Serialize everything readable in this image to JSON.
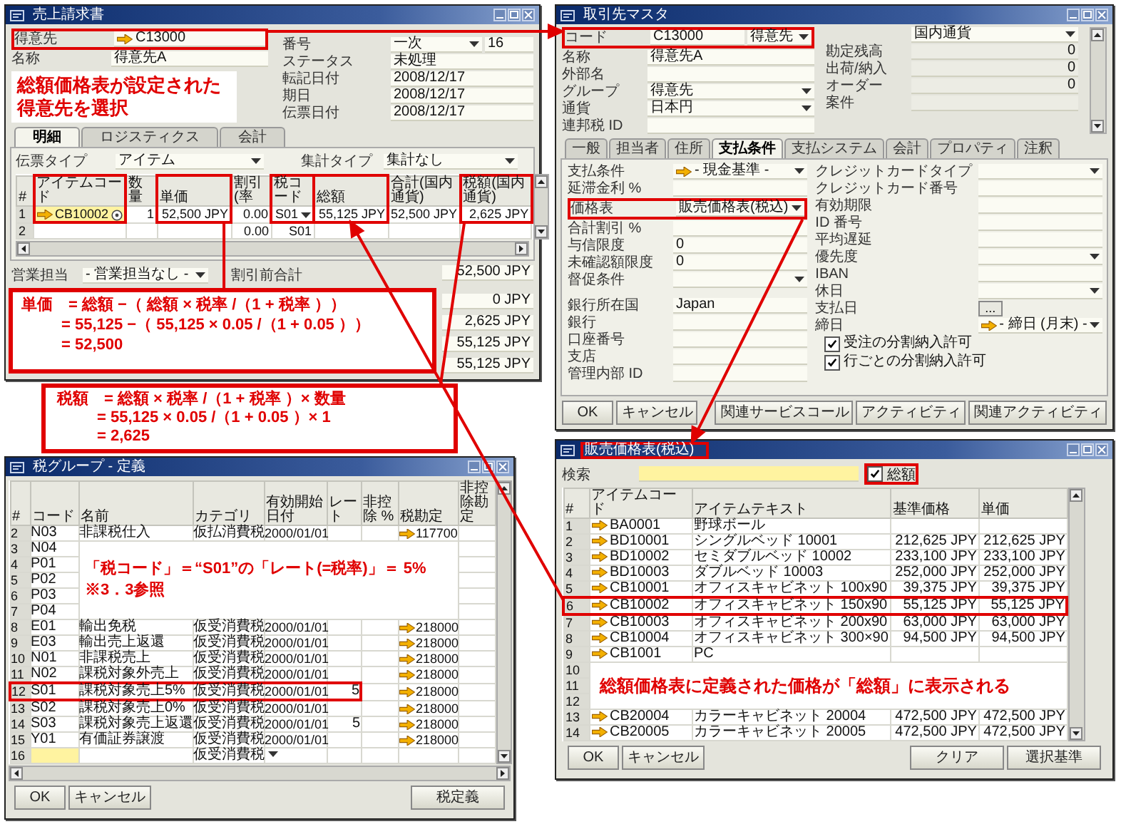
{
  "invoice": {
    "title": "売上請求書",
    "header_left": [
      {
        "label": "得意先",
        "value": "C13000",
        "link": true,
        "highlighted": true
      },
      {
        "label": "名称",
        "value": "得意先A",
        "link": false,
        "highlighted": false
      }
    ],
    "note": "総額価格表が設定された得意先を選択",
    "header_right": [
      {
        "label": "番号",
        "value": "一次",
        "dropdown": true,
        "extra": "16"
      },
      {
        "label": "ステータス",
        "value": "未処理",
        "dropdown": false
      },
      {
        "label": "転記日付",
        "value": "2008/12/17",
        "dropdown": false
      },
      {
        "label": "期日",
        "value": "2008/12/17",
        "dropdown": false
      },
      {
        "label": "伝票日付",
        "value": "2008/12/17",
        "dropdown": false
      }
    ],
    "tabs": [
      {
        "label": "明細",
        "selected": true
      },
      {
        "label": "ロジスティクス",
        "selected": false
      },
      {
        "label": "会計",
        "selected": false
      }
    ],
    "doc_type": {
      "label": "伝票タイプ",
      "value": "アイテム"
    },
    "summary_type": {
      "label": "集計タイプ",
      "value": "集計なし"
    },
    "columns": [
      {
        "label": "#",
        "highlighted": false
      },
      {
        "label": "アイテムコード",
        "highlighted": true
      },
      {
        "label": "数量",
        "highlighted": false
      },
      {
        "label": "単価",
        "highlighted": true
      },
      {
        "label": "割引(率",
        "highlighted": false
      },
      {
        "label": "税コード",
        "highlighted": true
      },
      {
        "label": "総額",
        "highlighted": true
      },
      {
        "label": "合計(国内通貨)",
        "highlighted": false
      },
      {
        "label": "税額(国内通貨)",
        "highlighted": true
      }
    ],
    "rows": [
      {
        "active": true,
        "framed": true,
        "cells": [
          "1",
          "CB10002",
          "1",
          "52,500 JPY",
          "0.00",
          "S01",
          "55,125 JPY",
          "52,500 JPY",
          "2,625 JPY"
        ]
      },
      {
        "active": false,
        "framed": false,
        "cells": [
          "2",
          null,
          null,
          null,
          "0.00",
          "S01",
          null,
          null,
          null
        ]
      }
    ],
    "sales_rep": {
      "label": "営業担当",
      "value": "- 営業担当なし -"
    },
    "totals_label": "割引前合計",
    "totals": [
      "52,500 JPY",
      "0 JPY",
      "2,625 JPY",
      "55,125 JPY",
      "55,125 JPY"
    ],
    "formula": [
      "単価　= 総額 −（ 総額 × 税率 /（1 + 税率 ））",
      "= 55,125 −（ 55,125 × 0.05 /（1 + 0.05 ））",
      "= 52,500"
    ]
  },
  "tax_formula": [
    "税額　= 総額 × 税率 /（1 + 税率 ）× 数量",
    "= 55,125 × 0.05 /（1 + 0.05 ）× 1",
    "= 2,625"
  ],
  "business_partner": {
    "title": "取引先マスタ",
    "header_left": [
      {
        "label": "コード",
        "value": "C13000",
        "option": "得意先",
        "highlighted": true
      },
      {
        "label": "名称",
        "value": "得意先A",
        "highlighted": false
      },
      {
        "label": "外部名",
        "highlighted": false
      },
      {
        "label": "グループ",
        "value": "得意先",
        "dropdown": true,
        "highlighted": false
      },
      {
        "label": "通貨",
        "value": "日本円",
        "dropdown": true,
        "highlighted": false
      },
      {
        "label": "連邦税 ID",
        "highlighted": false
      }
    ],
    "currency_option": "国内通貨",
    "header_right": [
      {
        "label": "勘定残高",
        "value": "0"
      },
      {
        "label": "出荷/納入",
        "value": "0"
      },
      {
        "label": "オーダー",
        "value": "0"
      },
      {
        "label": "案件"
      }
    ],
    "tabs": [
      {
        "label": "一般",
        "selected": false
      },
      {
        "label": "担当者",
        "selected": false
      },
      {
        "label": "住所",
        "selected": false
      },
      {
        "label": "支払条件",
        "selected": true
      },
      {
        "label": "支払システム",
        "selected": false
      },
      {
        "label": "会計",
        "selected": false
      },
      {
        "label": "プロパティ",
        "selected": false
      },
      {
        "label": "注釈",
        "selected": false
      }
    ],
    "left_groups": [
      [
        {
          "label": "支払条件",
          "value": "- 現金基準 -",
          "link": true,
          "dropdown": true,
          "highlighted": false
        },
        {
          "label": "延滞金利 %",
          "highlighted": false
        },
        {
          "label": "価格表",
          "value": "販売価格表(税込)",
          "dropdown": true,
          "highlighted": true
        },
        {
          "label": "合計割引 %",
          "highlighted": false
        },
        {
          "label": "与信限度",
          "value": "0",
          "highlighted": false
        },
        {
          "label": "未確認額限度",
          "value": "0",
          "highlighted": false
        },
        {
          "label": "督促条件",
          "dropdown": true,
          "highlighted": false
        }
      ],
      [
        {
          "label": "銀行所在国",
          "value": "Japan",
          "highlighted": false
        },
        {
          "label": "銀行",
          "highlighted": false
        },
        {
          "label": "口座番号",
          "highlighted": false
        },
        {
          "label": "支店",
          "highlighted": false
        },
        {
          "label": "管理内部 ID",
          "highlighted": false
        }
      ]
    ],
    "right_fields": [
      {
        "label": "クレジットカードタイプ",
        "dropdown": true
      },
      {
        "label": "クレジットカード番号"
      },
      {
        "label": "有効期限"
      },
      {
        "label": "ID 番号"
      },
      {
        "label": "平均遅延"
      },
      {
        "label": "優先度",
        "dropdown": true
      },
      {
        "label": "IBAN"
      },
      {
        "label": "休日",
        "dropdown": true
      },
      {
        "label": "支払日",
        "button": "..."
      },
      {
        "label": "締日",
        "value": "- 締日 (月末) -",
        "link": true,
        "dropdown": true
      }
    ],
    "checkboxes": [
      {
        "label": "受注の分割納入許可",
        "checked": true
      },
      {
        "label": "行ごとの分割納入許可",
        "checked": true
      }
    ],
    "buttons": [
      "OK",
      "キャンセル",
      "関連サービスコール",
      "アクティビティ",
      "関連アクティビティ"
    ]
  },
  "tax_groups": {
    "title": "税グループ - 定義",
    "columns": [
      "#",
      "コード",
      "名前",
      "カテゴリ",
      "有効開始日付",
      "レート",
      "非控除 %",
      "税勘定",
      "非控除勘定"
    ],
    "note": [
      "「税コード」＝“S01”の「レート(=税率)」＝ 5%",
      "※3．3参照"
    ],
    "rows": [
      {
        "kind": "row",
        "highlighted": false,
        "active": false,
        "cells": [
          "2",
          "N03",
          "非課税仕入",
          "仮払消費税",
          "2000/01/01",
          null,
          null,
          "117700",
          null
        ]
      },
      {
        "kind": "under_note",
        "highlighted": false,
        "active": false,
        "cells": [
          "3",
          "N04"
        ]
      },
      {
        "kind": "under_note",
        "highlighted": false,
        "active": false,
        "cells": [
          "4",
          "P01"
        ]
      },
      {
        "kind": "under_note",
        "highlighted": false,
        "active": false,
        "cells": [
          "5",
          "P02"
        ]
      },
      {
        "kind": "under_note",
        "highlighted": false,
        "active": false,
        "cells": [
          "6",
          "P03"
        ]
      },
      {
        "kind": "under_note",
        "highlighted": false,
        "active": false,
        "cells": [
          "7",
          "P04"
        ]
      },
      {
        "kind": "row",
        "highlighted": false,
        "active": false,
        "cells": [
          "8",
          "E01",
          "輸出免税",
          "仮受消費税",
          "2000/01/01",
          null,
          null,
          "218000",
          null
        ]
      },
      {
        "kind": "row",
        "highlighted": false,
        "active": false,
        "cells": [
          "9",
          "E03",
          "輸出売上返還",
          "仮受消費税",
          "2000/01/01",
          null,
          null,
          "218000",
          null
        ]
      },
      {
        "kind": "row",
        "highlighted": false,
        "active": false,
        "cells": [
          "10",
          "N01",
          "非課税売上",
          "仮受消費税",
          "2000/01/01",
          null,
          null,
          "218000",
          null
        ]
      },
      {
        "kind": "row",
        "highlighted": false,
        "active": false,
        "cells": [
          "11",
          "N02",
          "課税対象外売上",
          "仮受消費税",
          "2000/01/01",
          null,
          null,
          "218000",
          null
        ]
      },
      {
        "kind": "row",
        "highlighted": true,
        "active": false,
        "cells": [
          "12",
          "S01",
          "課税対象売上5%",
          "仮受消費税",
          "2000/01/01",
          "5",
          null,
          "218000",
          null
        ]
      },
      {
        "kind": "row",
        "highlighted": false,
        "active": false,
        "cells": [
          "13",
          "S02",
          "課税対象売上0%",
          "仮受消費税",
          "2000/01/01",
          null,
          null,
          "218000",
          null
        ]
      },
      {
        "kind": "row",
        "highlighted": false,
        "active": false,
        "cells": [
          "14",
          "S03",
          "課税対象売上返還",
          "仮受消費税",
          "2000/01/01",
          "5",
          null,
          "218000",
          null
        ]
      },
      {
        "kind": "row",
        "highlighted": false,
        "active": false,
        "cells": [
          "15",
          "Y01",
          "有価証券譲渡",
          "仮受消費税",
          "2000/01/01",
          null,
          null,
          "218000",
          null
        ]
      },
      {
        "kind": "row",
        "highlighted": false,
        "active": true,
        "cells": [
          "16",
          null,
          null,
          "仮受消費税",
          null,
          null,
          null,
          null,
          null
        ]
      }
    ],
    "buttons": [
      "OK",
      "キャンセル",
      "税定義"
    ]
  },
  "price_list": {
    "title": "販売価格表(税込)",
    "title_highlighted": true,
    "search": {
      "label": "検索"
    },
    "gross": {
      "label": "総額",
      "checked": true,
      "highlighted": true
    },
    "columns": [
      "#",
      "アイテムコード",
      "アイテムテキスト",
      "基準価格",
      "単価"
    ],
    "note": "総額価格表に定義された価格が「総額」に表示される",
    "rows": [
      {
        "kind": "row",
        "highlighted": false,
        "cells": [
          "1",
          "BA0001",
          "野球ボール",
          null,
          null
        ]
      },
      {
        "kind": "row",
        "highlighted": false,
        "cells": [
          "2",
          "BD10001",
          "シングルベッド 10001",
          "212,625 JPY",
          "212,625 JPY"
        ]
      },
      {
        "kind": "row",
        "highlighted": false,
        "cells": [
          "3",
          "BD10002",
          "セミダブルベッド 10002",
          "233,100 JPY",
          "233,100 JPY"
        ]
      },
      {
        "kind": "row",
        "highlighted": false,
        "cells": [
          "4",
          "BD10003",
          "ダブルベッド 10003",
          "252,000 JPY",
          "252,000 JPY"
        ]
      },
      {
        "kind": "row",
        "highlighted": false,
        "cells": [
          "5",
          "CB10001",
          "オフィスキャビネット 100x90",
          "39,375 JPY",
          "39,375 JPY"
        ]
      },
      {
        "kind": "row",
        "highlighted": true,
        "cells": [
          "6",
          "CB10002",
          "オフィスキャビネット 150x90",
          "55,125 JPY",
          "55,125 JPY"
        ]
      },
      {
        "kind": "row",
        "highlighted": false,
        "cells": [
          "7",
          "CB10003",
          "オフィスキャビネット 200x90",
          "63,000 JPY",
          "63,000 JPY"
        ]
      },
      {
        "kind": "row",
        "highlighted": false,
        "cells": [
          "8",
          "CB10004",
          "オフィスキャビネット 300×90",
          "94,500 JPY",
          "94,500 JPY"
        ]
      },
      {
        "kind": "row",
        "highlighted": false,
        "cells": [
          "9",
          "CB1001",
          "PC",
          null,
          null
        ]
      },
      {
        "kind": "under_note",
        "highlighted": false,
        "cells": [
          "10"
        ]
      },
      {
        "kind": "under_note",
        "highlighted": false,
        "cells": [
          "11"
        ]
      },
      {
        "kind": "under_note",
        "highlighted": false,
        "cells": [
          "12"
        ]
      },
      {
        "kind": "row",
        "highlighted": false,
        "cells": [
          "13",
          "CB20004",
          "カラーキャビネット 20004",
          "472,500 JPY",
          "472,500 JPY"
        ]
      },
      {
        "kind": "row",
        "highlighted": false,
        "cells": [
          "14",
          "CB20005",
          "カラーキャビネット 20005",
          "472,500 JPY",
          "472,500 JPY"
        ]
      }
    ],
    "buttons_left": [
      "OK",
      "キャンセル"
    ],
    "buttons_right": [
      "クリア",
      "選択基準"
    ]
  }
}
